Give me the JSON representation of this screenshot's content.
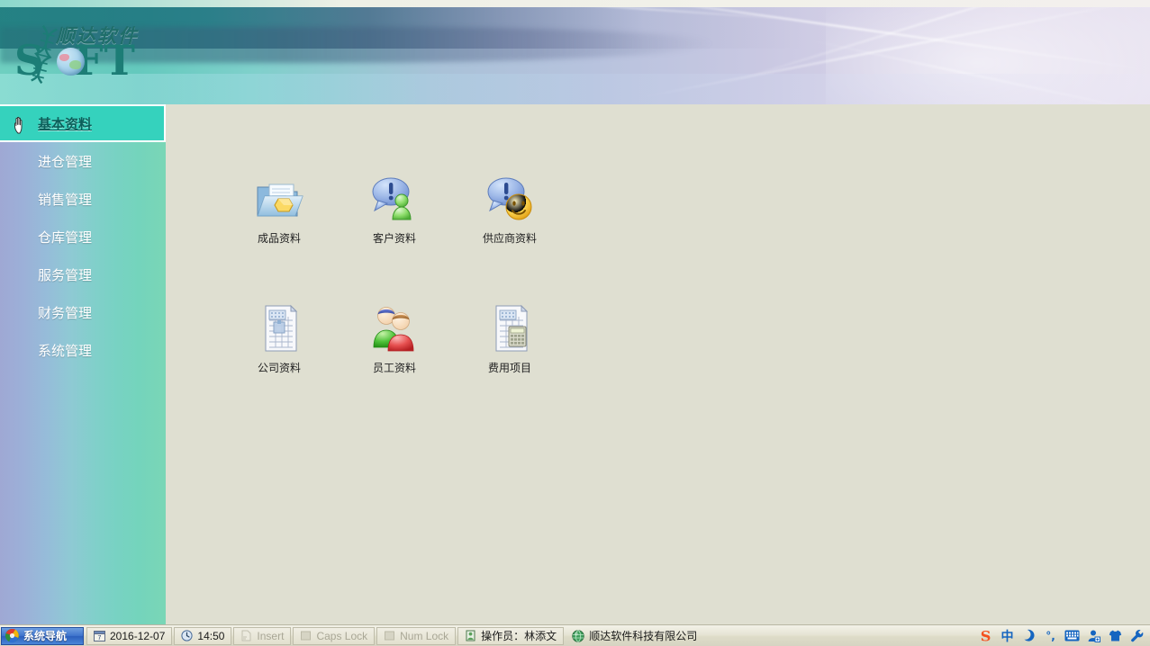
{
  "app": {
    "logo_cn": "顺达软件",
    "logo_en_1": "S",
    "logo_en_2": "FT",
    "company": "顺达软件科技有限公司"
  },
  "sidebar": {
    "items": [
      {
        "label": "基本资料",
        "selected": true
      },
      {
        "label": "进仓管理",
        "selected": false
      },
      {
        "label": "销售管理",
        "selected": false
      },
      {
        "label": "仓库管理",
        "selected": false
      },
      {
        "label": "服务管理",
        "selected": false
      },
      {
        "label": "财务管理",
        "selected": false
      },
      {
        "label": "系统管理",
        "selected": false
      }
    ]
  },
  "main": {
    "icons": [
      {
        "label": "成品资料",
        "icon": "folder-box-icon"
      },
      {
        "label": "客户资料",
        "icon": "chat-person-green-icon"
      },
      {
        "label": "供应商资料",
        "icon": "chat-smiley-icon"
      },
      {
        "label": "公司资料",
        "icon": "document-building-icon"
      },
      {
        "label": "员工资料",
        "icon": "two-people-icon"
      },
      {
        "label": "费用项目",
        "icon": "document-calculator-icon"
      }
    ]
  },
  "statusbar": {
    "start_label": "系统导航",
    "date": "2016-12-07",
    "time": "14:50",
    "insert": "Insert",
    "caps_lock": "Caps Lock",
    "num_lock": "Num Lock",
    "operator": "操作员：林添文",
    "company": "顺达软件科技有限公司",
    "tray": [
      {
        "name": "sogou-logo-icon",
        "glyph": "S"
      },
      {
        "name": "chinese-input-mode-icon",
        "glyph": "中"
      },
      {
        "name": "moon-icon",
        "glyph": "☽"
      },
      {
        "name": "punctuation-mode-icon",
        "glyph": "°,"
      },
      {
        "name": "soft-keyboard-icon",
        "glyph": "⌨"
      },
      {
        "name": "user-icon",
        "glyph": "👤"
      },
      {
        "name": "skin-shirt-icon",
        "glyph": "👕"
      },
      {
        "name": "toolbox-wrench-icon",
        "glyph": "🔧"
      }
    ]
  },
  "colors": {
    "accent_teal": "#35d2bd",
    "sidebar_left": "#9fa8d4",
    "sidebar_right": "#7ad6b6",
    "content_bg": "#dfdfd1",
    "selected_text": "#0b5f5a"
  }
}
